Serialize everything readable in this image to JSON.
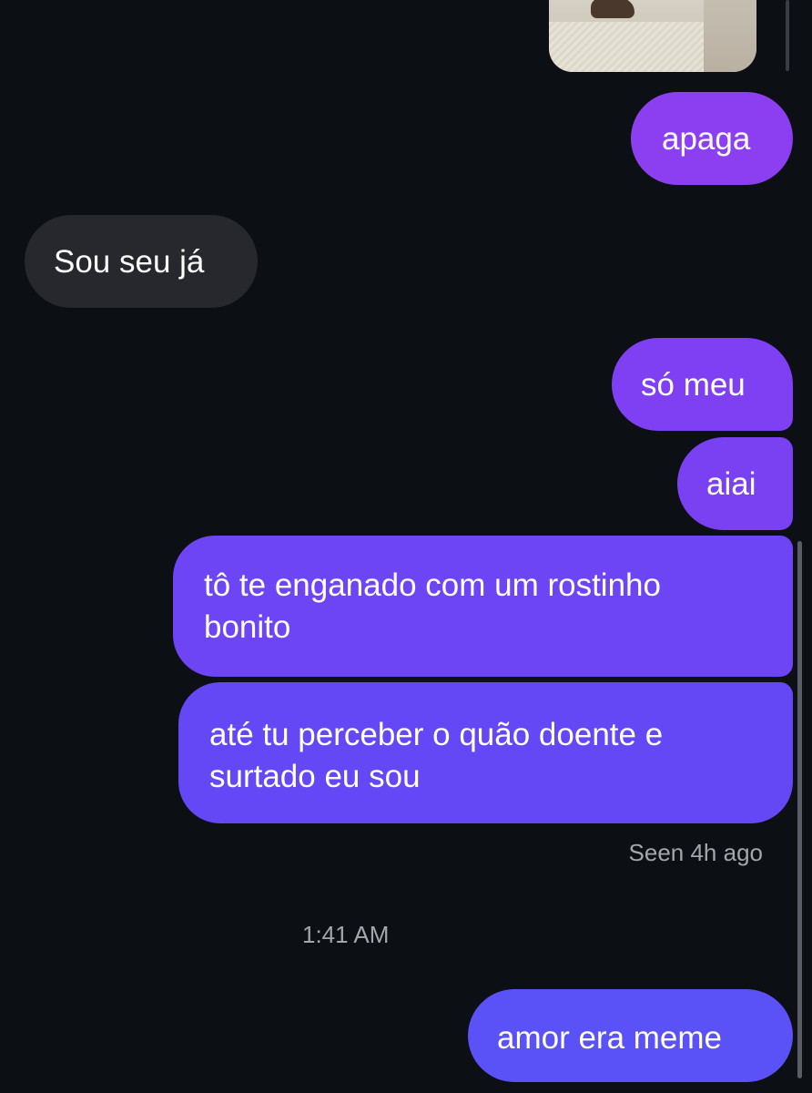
{
  "conversation": {
    "messages": [
      {
        "sender": "me",
        "type": "image",
        "alt": ""
      },
      {
        "sender": "me",
        "text": "apaga"
      },
      {
        "sender": "them",
        "text": "Sou seu já"
      },
      {
        "sender": "me",
        "text": "só meu"
      },
      {
        "sender": "me",
        "text": "aiai"
      },
      {
        "sender": "me",
        "text": "tô te enganado com um rostinho\nbonito"
      },
      {
        "sender": "me",
        "text": "até tu perceber o quão doente e\nsurtado eu sou"
      },
      {
        "sender": "me",
        "text": "amor era meme"
      }
    ],
    "seen_status": "Seen 4h ago",
    "timestamp": "1:41 AM"
  },
  "colors": {
    "background": "#0c0f14",
    "incoming_bubble": "#26282d",
    "outgoing_gradient_top": "#8f3ff0",
    "outgoing_gradient_bottom": "#5a51f6",
    "meta_text": "#a3a6ad"
  }
}
